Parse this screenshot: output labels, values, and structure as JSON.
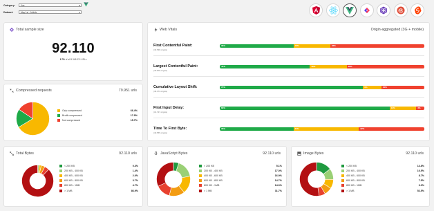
{
  "filters": {
    "category_label": "Category:",
    "category_value": "Vue",
    "dataset_label": "Dataset:",
    "dataset_value": "May 1st - Mobile"
  },
  "frameworks": [
    {
      "name": "angular-icon",
      "color": "#dd0031"
    },
    {
      "name": "react-icon",
      "color": "#61dafb"
    },
    {
      "name": "vue-icon",
      "color": "#41b883"
    },
    {
      "name": "svelte-kit-icon",
      "color": "#5a3be8"
    },
    {
      "name": "preact-icon",
      "color": "#673ab8"
    },
    {
      "name": "ember-icon",
      "color": "#e04e39"
    },
    {
      "name": "svelte-icon",
      "color": "#ff3e00"
    }
  ],
  "total_sample": {
    "title": "Total sample size",
    "value": "92.110",
    "pct": "1.7%",
    "suffix": "of all 5.348.374 URLs"
  },
  "web_vitals": {
    "title": "Web Vitals",
    "subtitle": "Origin-aggregated (3G + mobile)",
    "metrics": [
      {
        "name": "First Contentful Paint:",
        "origins": "(40.538 origins)",
        "good": 36,
        "ni": 18,
        "poor": 46,
        "good_label": "36%",
        "ni_label": "18%",
        "poor_label": "46%"
      },
      {
        "name": "Largest Contentful Paint:",
        "origins": "(40.609 origins)",
        "good": 44,
        "ni": 18,
        "poor": 38,
        "good_label": "44%",
        "ni_label": "18%",
        "poor_label": "38%"
      },
      {
        "name": "Cumulative Layout Shift:",
        "origins": "(46.374 origins)",
        "good": 70,
        "ni": 9,
        "poor": 21,
        "good_label": "70%",
        "ni_label": "9%",
        "poor_label": "21%"
      },
      {
        "name": "First Input Delay:",
        "origins": "(31.727 origins)",
        "good": 83,
        "ni": 13,
        "poor": 4,
        "good_label": "83%",
        "ni_label": "13%",
        "poor_label": "4%"
      },
      {
        "name": "Time To First Byte:",
        "origins": "(40.555 origins)",
        "good": 36,
        "ni": 32,
        "poor": 32,
        "good_label": "36%",
        "ni_label": "32%",
        "poor_label": "32%"
      }
    ],
    "colors": {
      "good": "#1faa48",
      "ni": "#f8b800",
      "poor": "#f0412e"
    }
  },
  "compressed": {
    "title": "Compressed requests",
    "urls": "79.951 urls",
    "legend": [
      {
        "label": "Gzip compressed",
        "value": "66.4%",
        "color": "#f8b800"
      },
      {
        "label": "Brotli compressed",
        "value": "17.9%",
        "color": "#1faa48"
      },
      {
        "label": "Not compressed",
        "value": "15.7%",
        "color": "#f0412e"
      }
    ],
    "chart_data": {
      "type": "pie",
      "categories": [
        "Gzip compressed",
        "Brotli compressed",
        "Not compressed"
      ],
      "values": [
        66.4,
        17.9,
        15.7
      ]
    }
  },
  "total_bytes": {
    "title": "Total Bytes",
    "urls": "92.110 urls",
    "legend": [
      {
        "label": "< 200 KB",
        "value": "0.3%",
        "color": "#1f9a3f"
      },
      {
        "label": "200 KB - 400 KB",
        "value": "1.4%",
        "color": "#9ad075"
      },
      {
        "label": "400 KB - 600 KB",
        "value": "2.0%",
        "color": "#f8b800"
      },
      {
        "label": "600 KB - 800 KB",
        "value": "3.7%",
        "color": "#f39c12"
      },
      {
        "label": "800 KB - 1MB",
        "value": "4.7%",
        "color": "#e8412f"
      },
      {
        "label": "> 1 MB",
        "value": "86.9%",
        "color": "#b31012"
      }
    ],
    "chart_data": {
      "type": "pie",
      "categories": [
        "< 200 KB",
        "200 KB - 400 KB",
        "400 KB - 600 KB",
        "600 KB - 800 KB",
        "800 KB - 1MB",
        "> 1 MB"
      ],
      "values": [
        0.3,
        1.4,
        2.0,
        3.7,
        4.7,
        86.9
      ]
    }
  },
  "js_bytes": {
    "title": "JavaScript Bytes",
    "urls": "92.110 urls",
    "legend": [
      {
        "label": "< 200 KB",
        "value": "5.1%",
        "color": "#1f9a3f"
      },
      {
        "label": "200 KB - 400 KB",
        "value": "17.0%",
        "color": "#9ad075"
      },
      {
        "label": "400 KB - 600 KB",
        "value": "16.9%",
        "color": "#f8b800"
      },
      {
        "label": "600 KB - 800 KB",
        "value": "14.7%",
        "color": "#f39c12"
      },
      {
        "label": "800 KB - 1MB",
        "value": "14.0%",
        "color": "#e8412f"
      },
      {
        "label": "> 1 MB",
        "value": "31.7%",
        "color": "#b31012"
      }
    ],
    "chart_data": {
      "type": "pie",
      "categories": [
        "< 200 KB",
        "200 KB - 400 KB",
        "400 KB - 600 KB",
        "600 KB - 800 KB",
        "800 KB - 1MB",
        "> 1 MB"
      ],
      "values": [
        5.1,
        17.0,
        16.9,
        14.7,
        14.0,
        31.7
      ]
    }
  },
  "image_bytes": {
    "title": "Image Bytes",
    "urls": "92.110 urls",
    "legend": [
      {
        "label": "< 200 KB",
        "value": "14.8%",
        "color": "#1f9a3f"
      },
      {
        "label": "200 KB - 400 KB",
        "value": "10.5%",
        "color": "#9ad075"
      },
      {
        "label": "400 KB - 600 KB",
        "value": "8.7%",
        "color": "#f8b800"
      },
      {
        "label": "600 KB - 800 KB",
        "value": "7.5%",
        "color": "#f39c12"
      },
      {
        "label": "800 KB - 1MB",
        "value": "6.0%",
        "color": "#e8412f"
      },
      {
        "label": "> 1 MB",
        "value": "52.5%",
        "color": "#b31012"
      }
    ],
    "chart_data": {
      "type": "pie",
      "categories": [
        "< 200 KB",
        "200 KB - 400 KB",
        "400 KB - 600 KB",
        "600 KB - 800 KB",
        "800 KB - 1MB",
        "> 1 MB"
      ],
      "values": [
        14.8,
        10.5,
        8.7,
        7.5,
        6.0,
        52.5
      ]
    }
  }
}
